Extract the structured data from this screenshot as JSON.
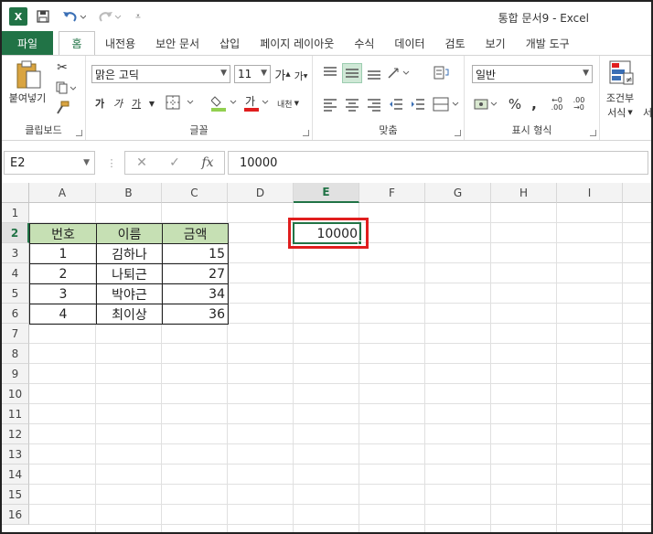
{
  "titlebar": {
    "app_icon": "excel-icon",
    "title": "통합 문서9 - Excel"
  },
  "tabs": [
    "파일",
    "홈",
    "내전용",
    "보안 문서",
    "삽입",
    "페이지 레이아웃",
    "수식",
    "데이터",
    "검토",
    "보기",
    "개발 도구"
  ],
  "ribbon": {
    "clipboard": {
      "paste": "붙여넣기",
      "label": "클립보드"
    },
    "font": {
      "name": "맑은 고딕",
      "size": "11",
      "label": "글꼴",
      "bold": "가",
      "italic": "가",
      "underline": "가",
      "text_wrap": "내천"
    },
    "alignment": {
      "label": "맞춤"
    },
    "number": {
      "format": "일반",
      "label": "표시 형식",
      "percent": "%"
    },
    "styles": {
      "cond_format_1": "조건부",
      "cond_format_2": "서식",
      "cell_style_partial": "서"
    }
  },
  "formula_bar": {
    "name_box": "E2",
    "fx": "fx",
    "value": "10000"
  },
  "grid": {
    "columns": [
      "A",
      "B",
      "C",
      "D",
      "E",
      "F",
      "G",
      "H",
      "I"
    ],
    "rows": [
      "1",
      "2",
      "3",
      "4",
      "5",
      "6",
      "7",
      "8",
      "9",
      "10",
      "11",
      "12",
      "13",
      "14",
      "15",
      "16"
    ],
    "table_headers": [
      "번호",
      "이름",
      "금액"
    ],
    "table_rows": [
      [
        "1",
        "김하나",
        "15"
      ],
      [
        "2",
        "나퇴근",
        "27"
      ],
      [
        "3",
        "박야근",
        "34"
      ],
      [
        "4",
        "최이상",
        "36"
      ]
    ],
    "e2_value": "10000",
    "active_cell": "E2"
  },
  "colors": {
    "accent": "#217346",
    "header_fill": "#c6e0b4",
    "highlight": "#e01e1e"
  }
}
